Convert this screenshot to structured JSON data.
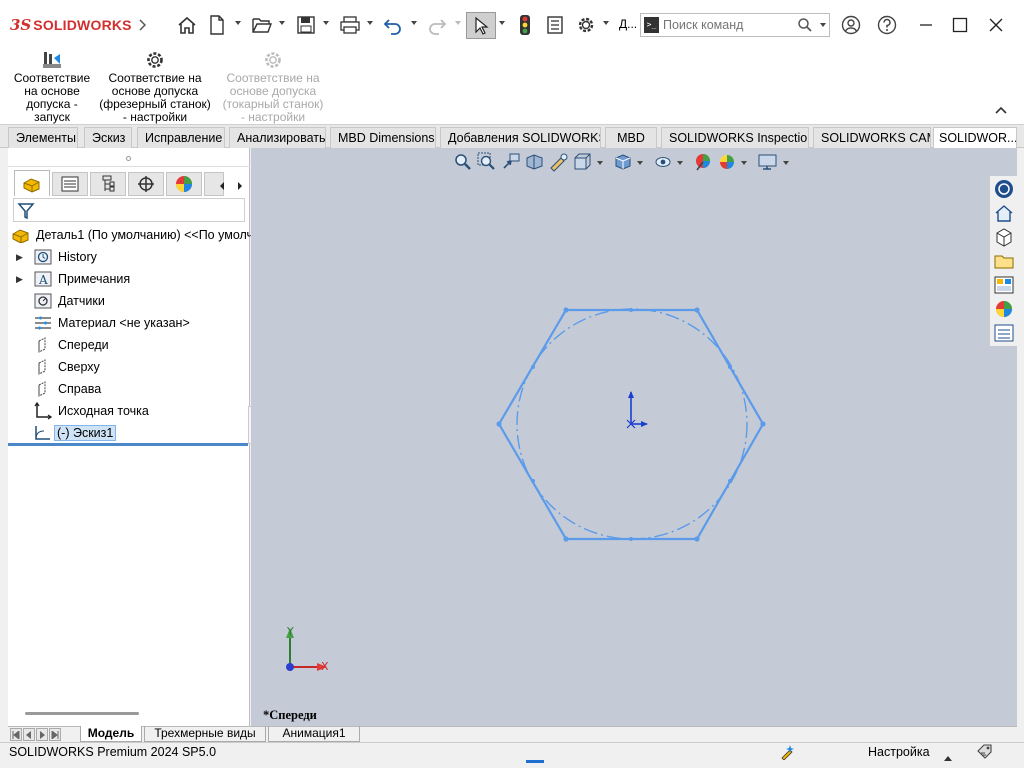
{
  "app": {
    "brand": "SOLIDWORKS",
    "brand_prefix": "3S"
  },
  "title": {
    "search_placeholder": "Поиск команд",
    "truncated_label": "Д...",
    "search_prompt_icon": ">_"
  },
  "commands": [
    {
      "label": "Соответствие на основе допуска - запуск",
      "enabled": true,
      "icon": "tolerance-start-icon"
    },
    {
      "label": "Соответствие на основе допуска (фрезерный станок) - настройки",
      "enabled": true,
      "icon": "gear-icon"
    },
    {
      "label": "Соответствие на основе допуска (токарный станок) - настройки",
      "enabled": false,
      "icon": "gear-icon"
    }
  ],
  "tabs": [
    {
      "label": "Элементы"
    },
    {
      "label": "Эскиз"
    },
    {
      "label": "Исправление"
    },
    {
      "label": "Анализировать"
    },
    {
      "label": "MBD Dimensions"
    },
    {
      "label": "Добавления SOLIDWORKS"
    },
    {
      "label": "MBD"
    },
    {
      "label": "SOLIDWORKS Inspection"
    },
    {
      "label": "SOLIDWORKS CAM"
    },
    {
      "label": "SOLIDWOR..."
    }
  ],
  "tree": {
    "root": "Деталь1 (По умолчанию) <<По умолч",
    "items": [
      {
        "label": "History",
        "expander": "▶",
        "icon": "history-icon"
      },
      {
        "label": "Примечания",
        "expander": "▶",
        "icon": "annotations-icon"
      },
      {
        "label": "Датчики",
        "expander": "",
        "icon": "sensors-icon"
      },
      {
        "label": "Материал <не указан>",
        "expander": "",
        "icon": "material-icon"
      },
      {
        "label": "Спереди",
        "expander": "",
        "icon": "plane-icon"
      },
      {
        "label": "Сверху",
        "expander": "",
        "icon": "plane-icon"
      },
      {
        "label": "Справа",
        "expander": "",
        "icon": "plane-icon"
      },
      {
        "label": "Исходная точка",
        "expander": "",
        "icon": "origin-icon"
      },
      {
        "label": "(-) Эскиз1",
        "expander": "",
        "icon": "sketch-icon",
        "selected": true
      }
    ]
  },
  "viewport": {
    "view_label": "*Спереди",
    "triad_x": "X",
    "triad_y": "Y"
  },
  "bottom_tabs": [
    {
      "label": "Модель",
      "active": true
    },
    {
      "label": "Трехмерные виды",
      "active": false
    },
    {
      "label": "Анимация1",
      "active": false
    }
  ],
  "status": {
    "product": "SOLIDWORKS Premium 2024 SP5.0",
    "settings_label": "Настройка"
  },
  "colors": {
    "accent": "#5b9bea",
    "brand_red": "#d32f2f",
    "viewport_bg": "#c5cbd6",
    "selection": "#cfe3f7"
  }
}
